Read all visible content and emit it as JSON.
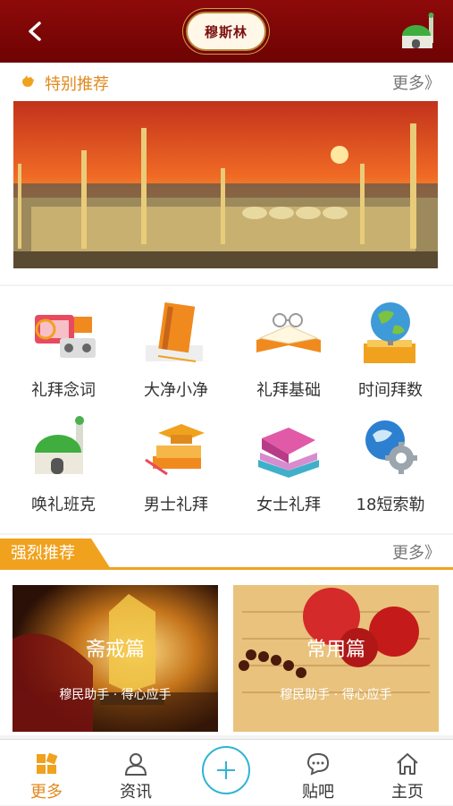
{
  "header": {
    "logo_text": "穆斯林",
    "back_icon": "chevron-left-icon",
    "right_icon": "mosque-icon"
  },
  "featured": {
    "title": "特别推荐",
    "more": "更多》",
    "banner_alt": "mosque-sunset-banner"
  },
  "grid": {
    "items": [
      {
        "label": "礼拜念词",
        "icon": "audio-icon"
      },
      {
        "label": "大净小净",
        "icon": "book-icon"
      },
      {
        "label": "礼拜基础",
        "icon": "open-book-icon"
      },
      {
        "label": "时间拜数",
        "icon": "globe-icon"
      },
      {
        "label": "唤礼班克",
        "icon": "mosque-icon"
      },
      {
        "label": "男士礼拜",
        "icon": "graduation-icon"
      },
      {
        "label": "女士礼拜",
        "icon": "books-icon"
      },
      {
        "label": "18短索勒",
        "icon": "globe-gear-icon"
      }
    ]
  },
  "recommended": {
    "title": "强烈推荐",
    "more": "更多》",
    "cards": [
      {
        "title": "斋戒篇",
        "subtitle": "穆民助手 · 得心应手"
      },
      {
        "title": "常用篇",
        "subtitle": "穆民助手 · 得心应手"
      }
    ]
  },
  "tabbar": {
    "tabs": [
      {
        "label": "更多",
        "icon": "grid-icon"
      },
      {
        "label": "资讯",
        "icon": "user-icon"
      },
      {
        "label": "",
        "icon": "plus-icon"
      },
      {
        "label": "贴吧",
        "icon": "chat-icon"
      },
      {
        "label": "主页",
        "icon": "home-icon"
      }
    ]
  },
  "colors": {
    "header": "#7a0606",
    "accent": "#f0a21e",
    "plus": "#2fb4d4"
  }
}
